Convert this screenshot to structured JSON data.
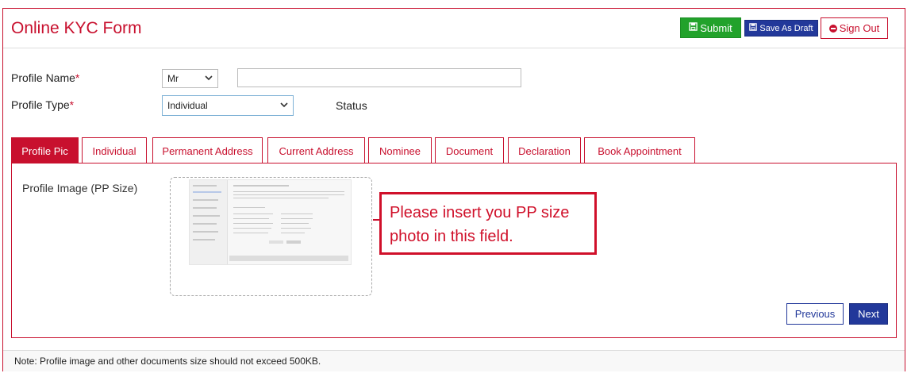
{
  "header": {
    "title": "Online KYC Form",
    "submit_label": "Submit",
    "draft_label": "Save As Draft",
    "signout_label": "Sign Out"
  },
  "form": {
    "profile_name_label": "Profile Name",
    "required_mark": "*",
    "title_select_value": "Mr",
    "profile_name_value": "",
    "profile_type_label": "Profile Type",
    "profile_type_value": "Individual",
    "status_label": "Status"
  },
  "tabs": [
    {
      "label": "Profile Pic",
      "active": true
    },
    {
      "label": "Individual"
    },
    {
      "label": "Permanent Address"
    },
    {
      "label": "Current Address"
    },
    {
      "label": "Nominee"
    },
    {
      "label": "Document"
    },
    {
      "label": "Declaration"
    },
    {
      "label": "Book Appointment"
    }
  ],
  "panel": {
    "image_label": "Profile Image (PP Size)",
    "callout_text": "Please insert you PP size photo in this field.",
    "previous_label": "Previous",
    "next_label": "Next"
  },
  "footer": {
    "note": "Note: Profile image and other documents size should not exceed 500KB."
  },
  "colors": {
    "brand_red": "#c8102e",
    "submit_green": "#22a22b",
    "primary_blue": "#22389a"
  },
  "icons": {
    "submit": "save-icon",
    "draft": "save-icon",
    "signout": "minus-circle-icon"
  }
}
